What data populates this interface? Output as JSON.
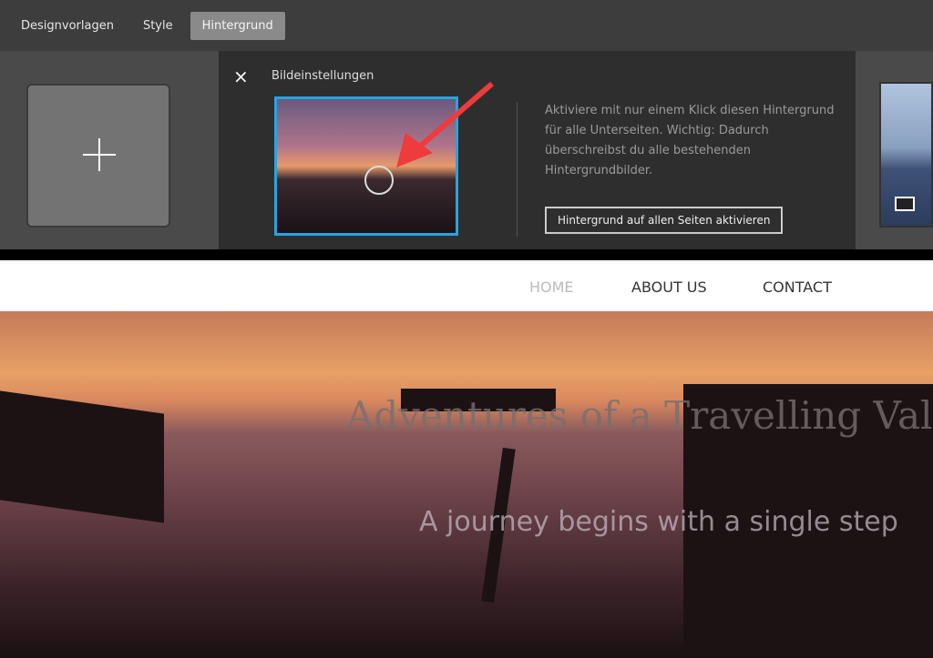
{
  "tabs": [
    {
      "label": "Designvorlagen"
    },
    {
      "label": "Style"
    },
    {
      "label": "Hintergrund",
      "active": true
    }
  ],
  "panel": {
    "close_icon": "×",
    "title": "Bildeinstellungen",
    "description": "Aktiviere mit nur einem Klick diesen Hintergrund für alle Unterseiten. Wichtig: Dadurch überschreibst du alle bestehenden Hintergrundbilder.",
    "apply_button": "Hintergrund auf allen Seiten aktivieren",
    "accent": "#29a3e0"
  },
  "nav": {
    "items": [
      {
        "label": "HOME"
      },
      {
        "label": "ABOUT US"
      },
      {
        "label": "CONTACT"
      }
    ]
  },
  "hero": {
    "title": "Adventures of a Travelling Valk",
    "subtitle": "A journey begins with a single step"
  }
}
